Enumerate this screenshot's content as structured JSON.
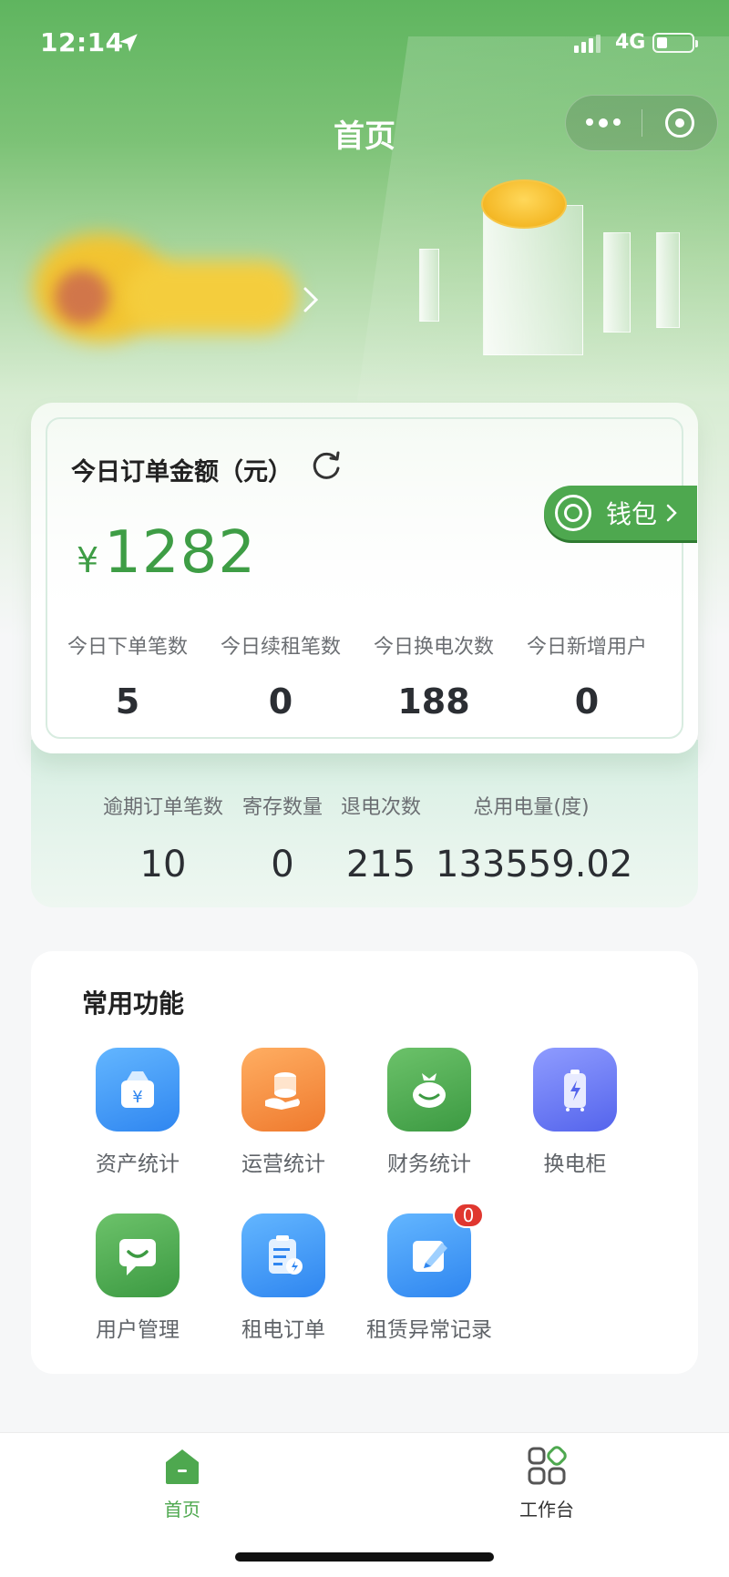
{
  "status_bar": {
    "time": "12:14",
    "network": "4G",
    "battery_level": 0.3
  },
  "nav": {
    "title": "首页"
  },
  "card": {
    "title": "今日订单金额（元）",
    "currency_symbol": "¥",
    "amount": "1282",
    "stats": [
      {
        "label": "今日下单笔数",
        "value": "5"
      },
      {
        "label": "今日续租笔数",
        "value": "0"
      },
      {
        "label": "今日换电次数",
        "value": "188"
      },
      {
        "label": "今日新增用户",
        "value": "0"
      }
    ]
  },
  "wallet": {
    "label": "钱包"
  },
  "secondary_stats": [
    {
      "label": "逾期订单笔数",
      "value": "10"
    },
    {
      "label": "寄存数量",
      "value": "0"
    },
    {
      "label": "退电次数",
      "value": "215"
    },
    {
      "label": "总用电量(度)",
      "value": "133559.02"
    }
  ],
  "functions": {
    "title": "常用功能",
    "items": [
      {
        "label": "资产统计",
        "icon": "asset-bag-icon"
      },
      {
        "label": "运营统计",
        "icon": "coin-stack-icon"
      },
      {
        "label": "财务统计",
        "icon": "money-bag-icon"
      },
      {
        "label": "换电柜",
        "icon": "battery-cabinet-icon"
      },
      {
        "label": "用户管理",
        "icon": "user-chat-icon"
      },
      {
        "label": "租电订单",
        "icon": "order-clipboard-icon"
      },
      {
        "label": "租赁异常记录",
        "icon": "edit-note-icon",
        "badge": "0"
      }
    ]
  },
  "tabbar": {
    "tabs": [
      {
        "label": "首页",
        "active": true
      },
      {
        "label": "工作台",
        "active": false
      }
    ]
  },
  "colors": {
    "brand_green": "#4ea84f",
    "amount_green": "#3e9d45",
    "badge_red": "#e0372f"
  }
}
